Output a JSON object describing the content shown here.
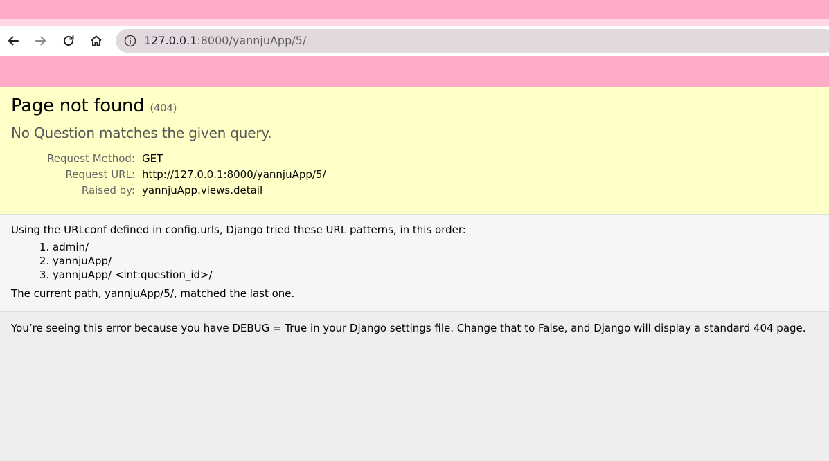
{
  "browser": {
    "url_host": "127.0.0.1",
    "url_rest": ":8000/yannjuApp/5/",
    "icons": {
      "back": "arrow-left-icon",
      "forward": "arrow-right-icon",
      "reload": "reload-icon",
      "home": "home-icon",
      "site_info": "info-icon"
    }
  },
  "summary": {
    "title": "Page not found",
    "status_code": "(404)",
    "reason": "No Question matches the given query.",
    "meta": [
      {
        "label": "Request Method:",
        "value": "GET"
      },
      {
        "label": "Request URL:",
        "value": "http://127.0.0.1:8000/yannjuApp/5/"
      },
      {
        "label": "Raised by:",
        "value": "yannjuApp.views.detail"
      }
    ]
  },
  "info": {
    "intro": "Using the URLconf defined in config.urls, Django tried these URL patterns, in this order:",
    "patterns": [
      "admin/",
      "yannjuApp/",
      "yannjuApp/ <int:question_id>/"
    ],
    "outro": "The current path, yannjuApp/5/, matched the last one."
  },
  "explanation": {
    "text": "You’re seeing this error because you have DEBUG = True in your Django settings file. Change that to False, and Django will display a standard 404 page."
  },
  "colors": {
    "chrome_pink": "#ffaac7",
    "summary_bg": "#ffffc8",
    "info_bg": "#f6f6f6",
    "page_bg": "#eeeeee"
  }
}
